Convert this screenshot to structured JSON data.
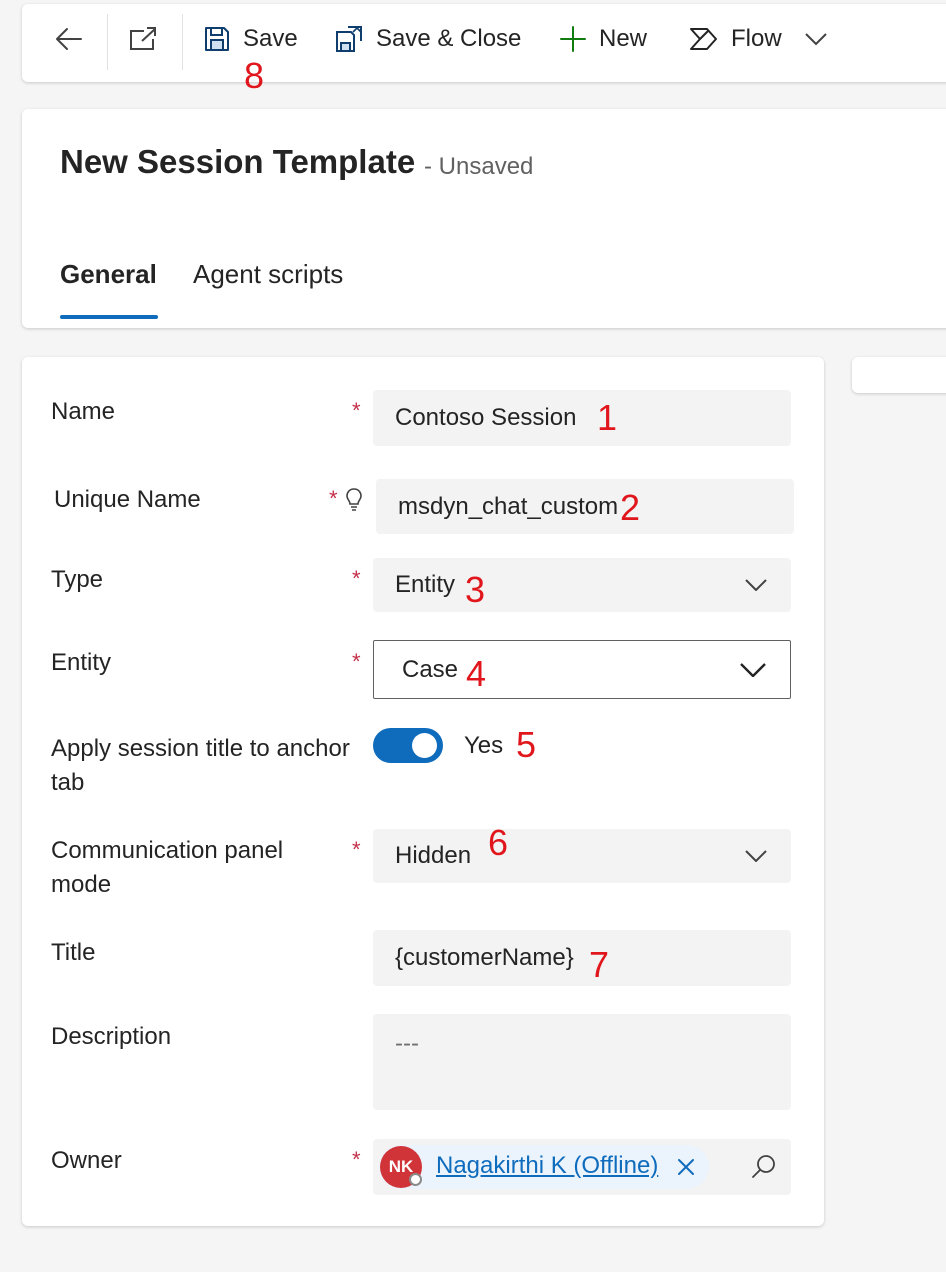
{
  "toolbar": {
    "save_label": "Save",
    "save_close_label": "Save & Close",
    "new_label": "New",
    "flow_label": "Flow",
    "save_marker": "8"
  },
  "header": {
    "title": "New Session Template",
    "status": "- Unsaved",
    "tabs": [
      "General",
      "Agent scripts"
    ]
  },
  "form": {
    "name": {
      "label": "Name",
      "value": "Contoso Session",
      "marker": "1"
    },
    "unique_name": {
      "label": "Unique Name",
      "value": "msdyn_chat_custom",
      "marker": "2"
    },
    "type": {
      "label": "Type",
      "value": "Entity",
      "marker": "3"
    },
    "entity": {
      "label": "Entity",
      "value": "Case",
      "marker": "4"
    },
    "apply_title": {
      "label": "Apply session title to anchor tab",
      "value": "Yes",
      "marker": "5"
    },
    "comm_panel": {
      "label": "Communication panel mode",
      "value": "Hidden",
      "marker": "6"
    },
    "title": {
      "label": "Title",
      "value": "{customerName}",
      "marker": "7"
    },
    "description": {
      "label": "Description",
      "placeholder": "---"
    },
    "owner": {
      "label": "Owner",
      "initials": "NK",
      "value": "Nagakirthi K (Offline)"
    }
  },
  "colors": {
    "accent": "#0f6cbd",
    "required": "#c4314b",
    "annotation": "#e0161c",
    "avatar": "#d13438",
    "new_icon": "#107c10"
  },
  "icons": [
    "back-arrow-icon",
    "open-new-window-icon",
    "save-icon",
    "save-close-icon",
    "plus-icon",
    "flow-icon",
    "chevron-down-icon",
    "lightbulb-icon",
    "dismiss-icon",
    "search-icon"
  ]
}
